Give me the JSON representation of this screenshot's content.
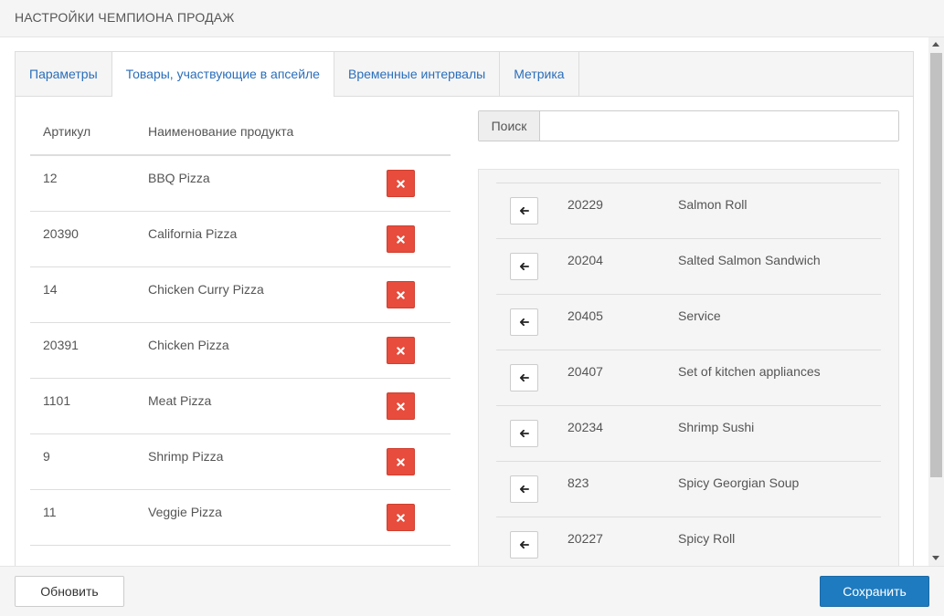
{
  "header": {
    "title": "НАСТРОЙКИ ЧЕМПИОНА ПРОДАЖ"
  },
  "tabs": [
    {
      "label": "Параметры",
      "active": false
    },
    {
      "label": "Товары, участвующие в апсейле",
      "active": true
    },
    {
      "label": "Временные интервалы",
      "active": false
    },
    {
      "label": "Метрика",
      "active": false
    }
  ],
  "selected_table": {
    "columns": {
      "sku": "Артикул",
      "name": "Наименование продукта"
    },
    "rows": [
      {
        "sku": "12",
        "name": "BBQ Pizza"
      },
      {
        "sku": "20390",
        "name": "California Pizza"
      },
      {
        "sku": "14",
        "name": "Chicken Curry Pizza"
      },
      {
        "sku": "20391",
        "name": "Chicken Pizza"
      },
      {
        "sku": "1101",
        "name": "Meat Pizza"
      },
      {
        "sku": "9",
        "name": "Shrimp Pizza"
      },
      {
        "sku": "11",
        "name": "Veggie Pizza"
      }
    ],
    "remove_icon": "times-icon",
    "remove_color": "#e74c3c"
  },
  "search": {
    "label": "Поиск",
    "value": "",
    "placeholder": ""
  },
  "available_list": {
    "add_icon": "arrow-left-icon",
    "rows": [
      {
        "sku": "20229",
        "name": "Salmon Roll"
      },
      {
        "sku": "20204",
        "name": "Salted Salmon Sandwich"
      },
      {
        "sku": "20405",
        "name": "Service"
      },
      {
        "sku": "20407",
        "name": "Set of kitchen appliances"
      },
      {
        "sku": "20234",
        "name": "Shrimp Sushi"
      },
      {
        "sku": "823",
        "name": "Spicy Georgian Soup"
      },
      {
        "sku": "20227",
        "name": "Spicy Roll"
      }
    ]
  },
  "footer": {
    "refresh_label": "Обновить",
    "save_label": "Сохранить",
    "primary_color": "#1f7bbf"
  }
}
